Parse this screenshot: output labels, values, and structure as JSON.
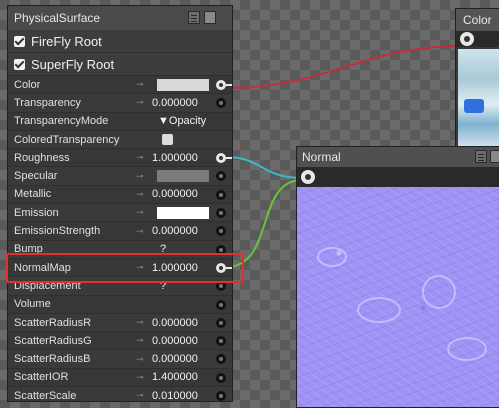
{
  "node_panel": {
    "title": "PhysicalSurface",
    "headers": [
      {
        "label": "FireFly Root",
        "checked": true
      },
      {
        "label": "SuperFly Root",
        "checked": true
      }
    ],
    "properties": [
      {
        "name": "Color",
        "kind": "swatch",
        "swatch": "#d9d9d9",
        "socket": "connected"
      },
      {
        "name": "Transparency",
        "kind": "value",
        "value": "0.000000",
        "socket": "empty"
      },
      {
        "name": "TransparencyMode",
        "kind": "mode",
        "value": "▼Opacity",
        "socket": "none"
      },
      {
        "name": "ColoredTransparency",
        "kind": "check",
        "socket": "none"
      },
      {
        "name": "Roughness",
        "kind": "value",
        "value": "1.000000",
        "socket": "connected"
      },
      {
        "name": "Specular",
        "kind": "swatch",
        "swatch": "#7a7a7a",
        "socket": "empty"
      },
      {
        "name": "Metallic",
        "kind": "value",
        "value": "0.000000",
        "socket": "empty"
      },
      {
        "name": "Emission",
        "kind": "swatch",
        "swatch": "#ffffff",
        "socket": "empty"
      },
      {
        "name": "EmissionStrength",
        "kind": "value",
        "value": "0.000000",
        "socket": "empty"
      },
      {
        "name": "Bump",
        "kind": "q",
        "value": "?",
        "socket": "empty"
      },
      {
        "name": "NormalMap",
        "kind": "value",
        "value": "1.000000",
        "socket": "connected"
      },
      {
        "name": "Displacement",
        "kind": "q",
        "value": "?",
        "socket": "empty"
      },
      {
        "name": "Volume",
        "kind": "none",
        "socket": "empty"
      },
      {
        "name": "ScatterRadiusR",
        "kind": "value",
        "value": "0.000000",
        "socket": "empty"
      },
      {
        "name": "ScatterRadiusG",
        "kind": "value",
        "value": "0.000000",
        "socket": "empty"
      },
      {
        "name": "ScatterRadiusB",
        "kind": "value",
        "value": "0.000000",
        "socket": "empty"
      },
      {
        "name": "ScatterIOR",
        "kind": "value",
        "value": "1.400000",
        "socket": "empty"
      },
      {
        "name": "ScatterScale",
        "kind": "value",
        "value": "0.010000",
        "socket": "empty"
      }
    ]
  },
  "color_node": {
    "title": "Color"
  },
  "normal_node": {
    "title": "Normal"
  },
  "colors": {
    "wire_color": "#c0303a",
    "wire_roughness": "#3fb8c0",
    "wire_normal": "#6cc040",
    "highlight": "#e03030"
  }
}
